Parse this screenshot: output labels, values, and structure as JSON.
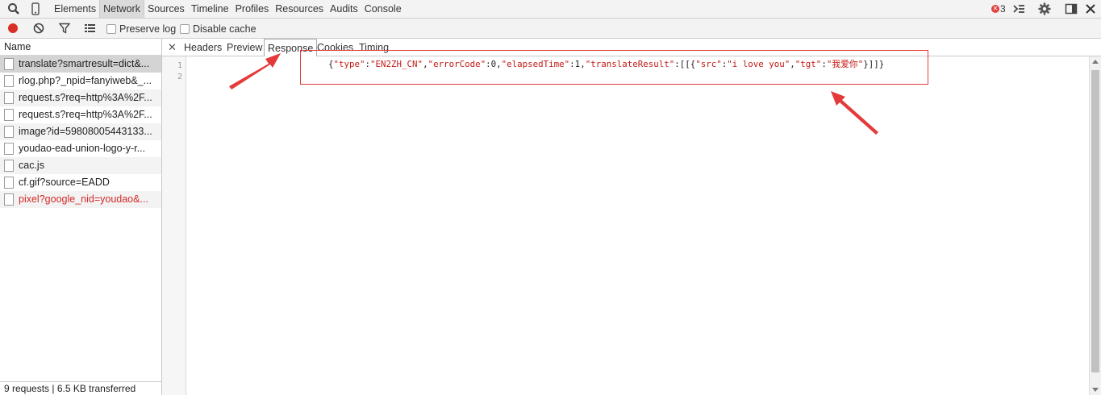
{
  "top_tabs": [
    "Elements",
    "Network",
    "Sources",
    "Timeline",
    "Profiles",
    "Resources",
    "Audits",
    "Console"
  ],
  "active_top_tab": "Network",
  "error_count": "3",
  "toolbar": {
    "preserve_log": "Preserve log",
    "disable_cache": "Disable cache"
  },
  "requests": {
    "header": "Name",
    "items": [
      "translate?smartresult=dict&...",
      "rlog.php?_npid=fanyiweb&_...",
      "request.s?req=http%3A%2F...",
      "request.s?req=http%3A%2F...",
      "image?id=59808005443133...",
      "youdao-ead-union-logo-y-r...",
      "cac.js",
      "cf.gif?source=EADD",
      "pixel?google_nid=youdao&..."
    ],
    "footer": "9 requests | 6.5 KB transferred"
  },
  "detail_tabs": [
    "Headers",
    "Preview",
    "Response",
    "Cookies",
    "Timing"
  ],
  "active_detail_tab": "Response",
  "line_numbers": [
    "1",
    "2"
  ],
  "response": {
    "k_type": "\"type\"",
    "v_type": "\"EN2ZH_CN\"",
    "k_error": "\"errorCode\"",
    "v_error": "0",
    "k_elapsed": "\"elapsedTime\"",
    "v_elapsed": "1",
    "k_result": "\"translateResult\"",
    "k_src": "\"src\"",
    "v_src": "\"i love you\"",
    "k_tgt": "\"tgt\"",
    "v_tgt": "\"我爱你\""
  },
  "colors": {
    "accent_red": "#e53a3a",
    "string": "#c41a16",
    "record": "#d93025"
  }
}
